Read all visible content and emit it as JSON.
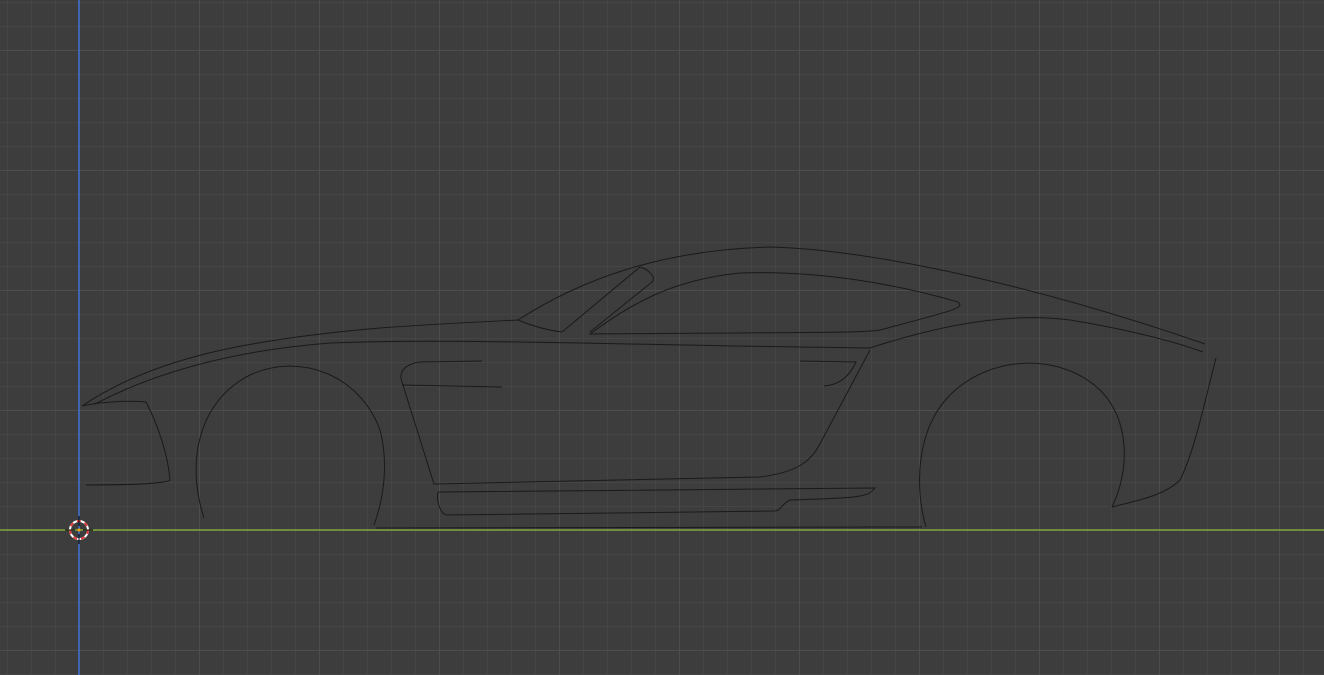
{
  "viewport": {
    "view": "side-orthographic",
    "background_color": "#3d3d3d",
    "grid_color": "#4d4d4d",
    "x_axis_color": "#7fa33c",
    "z_axis_color": "#3e6fd1",
    "curve_color": "#1a1a1a",
    "cursor_icon": "3d-cursor-icon",
    "objects": [
      "car-side-outline-curve"
    ]
  }
}
